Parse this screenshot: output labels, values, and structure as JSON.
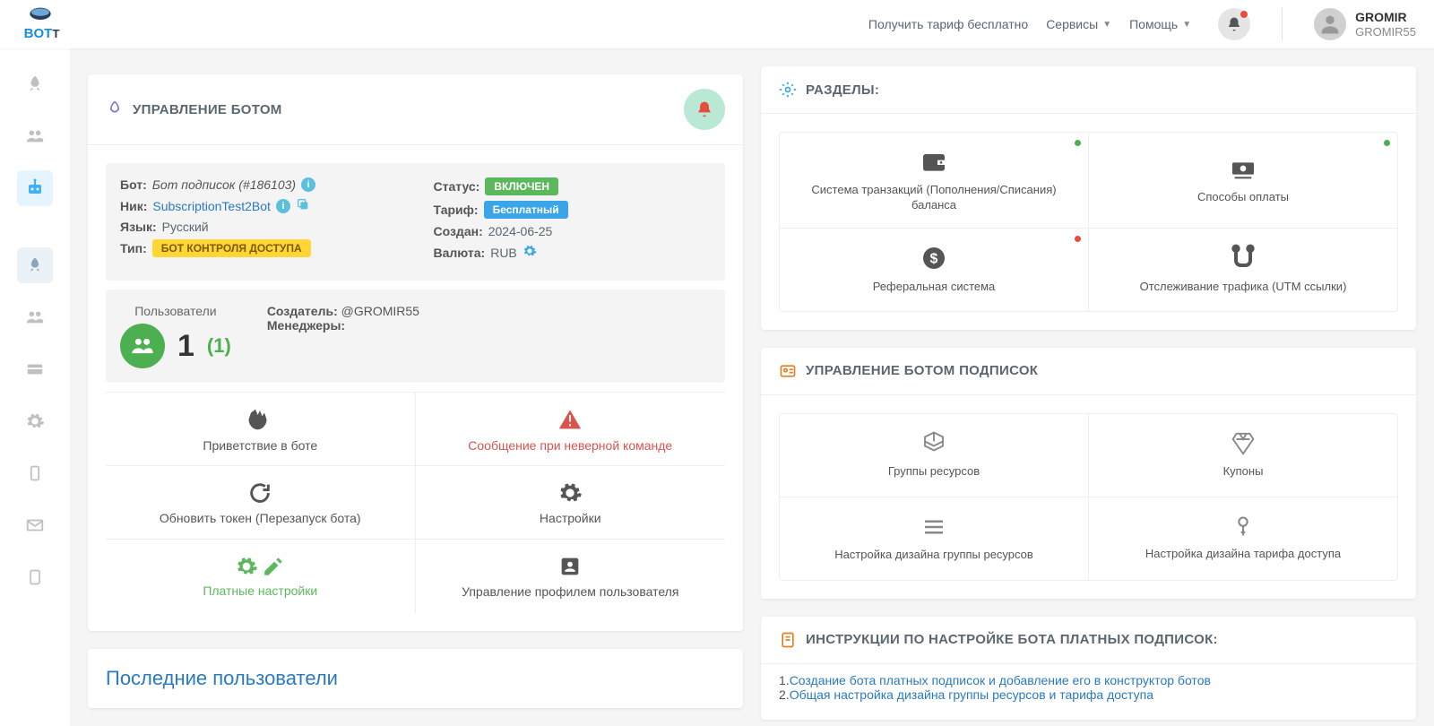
{
  "header": {
    "free_tariff": "Получить тариф бесплатно",
    "services": "Сервисы",
    "help": "Помощь",
    "user": {
      "name": "GROMIR",
      "login": "GROMIR55"
    }
  },
  "panels": {
    "bot_manage_title": "УПРАВЛЕНИЕ БОТОМ",
    "sections_title": "РАЗДЕЛЫ:",
    "sub_manage_title": "УПРАВЛЕНИЕ БОТОМ ПОДПИСОК",
    "instructions_title": "ИНСТРУКЦИИ ПО НАСТРОЙКЕ БОТА ПЛАТНЫХ ПОДПИСОК:",
    "last_users_title": "Последние пользователи"
  },
  "bot": {
    "labels": {
      "bot": "Бот:",
      "nick": "Ник:",
      "lang": "Язык:",
      "type": "Тип:",
      "status": "Статус:",
      "tariff": "Тариф:",
      "created": "Создан:",
      "currency": "Валюта:"
    },
    "name": "Бот подписок (#186103)",
    "nick": "SubscriptionTest2Bot",
    "lang": "Русский",
    "type_badge": "БОТ КОНТРОЛЯ ДОСТУПА",
    "status_badge": "ВКЛЮЧЕН",
    "tariff_badge": "Бесплатный",
    "created": "2024-06-25",
    "currency": "RUB"
  },
  "stats": {
    "users_label": "Пользователи",
    "count": "1",
    "sub": "(1)",
    "creator_label": "Создатель:",
    "creator": "@GROMIR55",
    "managers_label": "Менеджеры:"
  },
  "actions": {
    "greeting": "Приветствие в боте",
    "wrong_cmd": "Сообщение при неверной команде",
    "refresh_token": "Обновить токен (Перезапуск бота)",
    "settings": "Настройки",
    "paid_settings": "Платные настройки",
    "profile_manage": "Управление профилем пользователя"
  },
  "sections": {
    "transactions": "Система транзакций (Пополнения/Списания) баланса",
    "payment_methods": "Способы оплаты",
    "referral": "Реферальная система",
    "utm": "Отслеживание трафика (UTM ссылки)"
  },
  "sub_sections": {
    "resource_groups": "Группы ресурсов",
    "coupons": "Купоны",
    "group_design": "Настройка дизайна группы ресурсов",
    "tariff_design": "Настройка дизайна тарифа доступа"
  },
  "instructions": [
    "Создание бота платных подписок и добавление его в конструктор ботов",
    "Общая настройка дизайна группы ресурсов и тарифа доступа"
  ]
}
